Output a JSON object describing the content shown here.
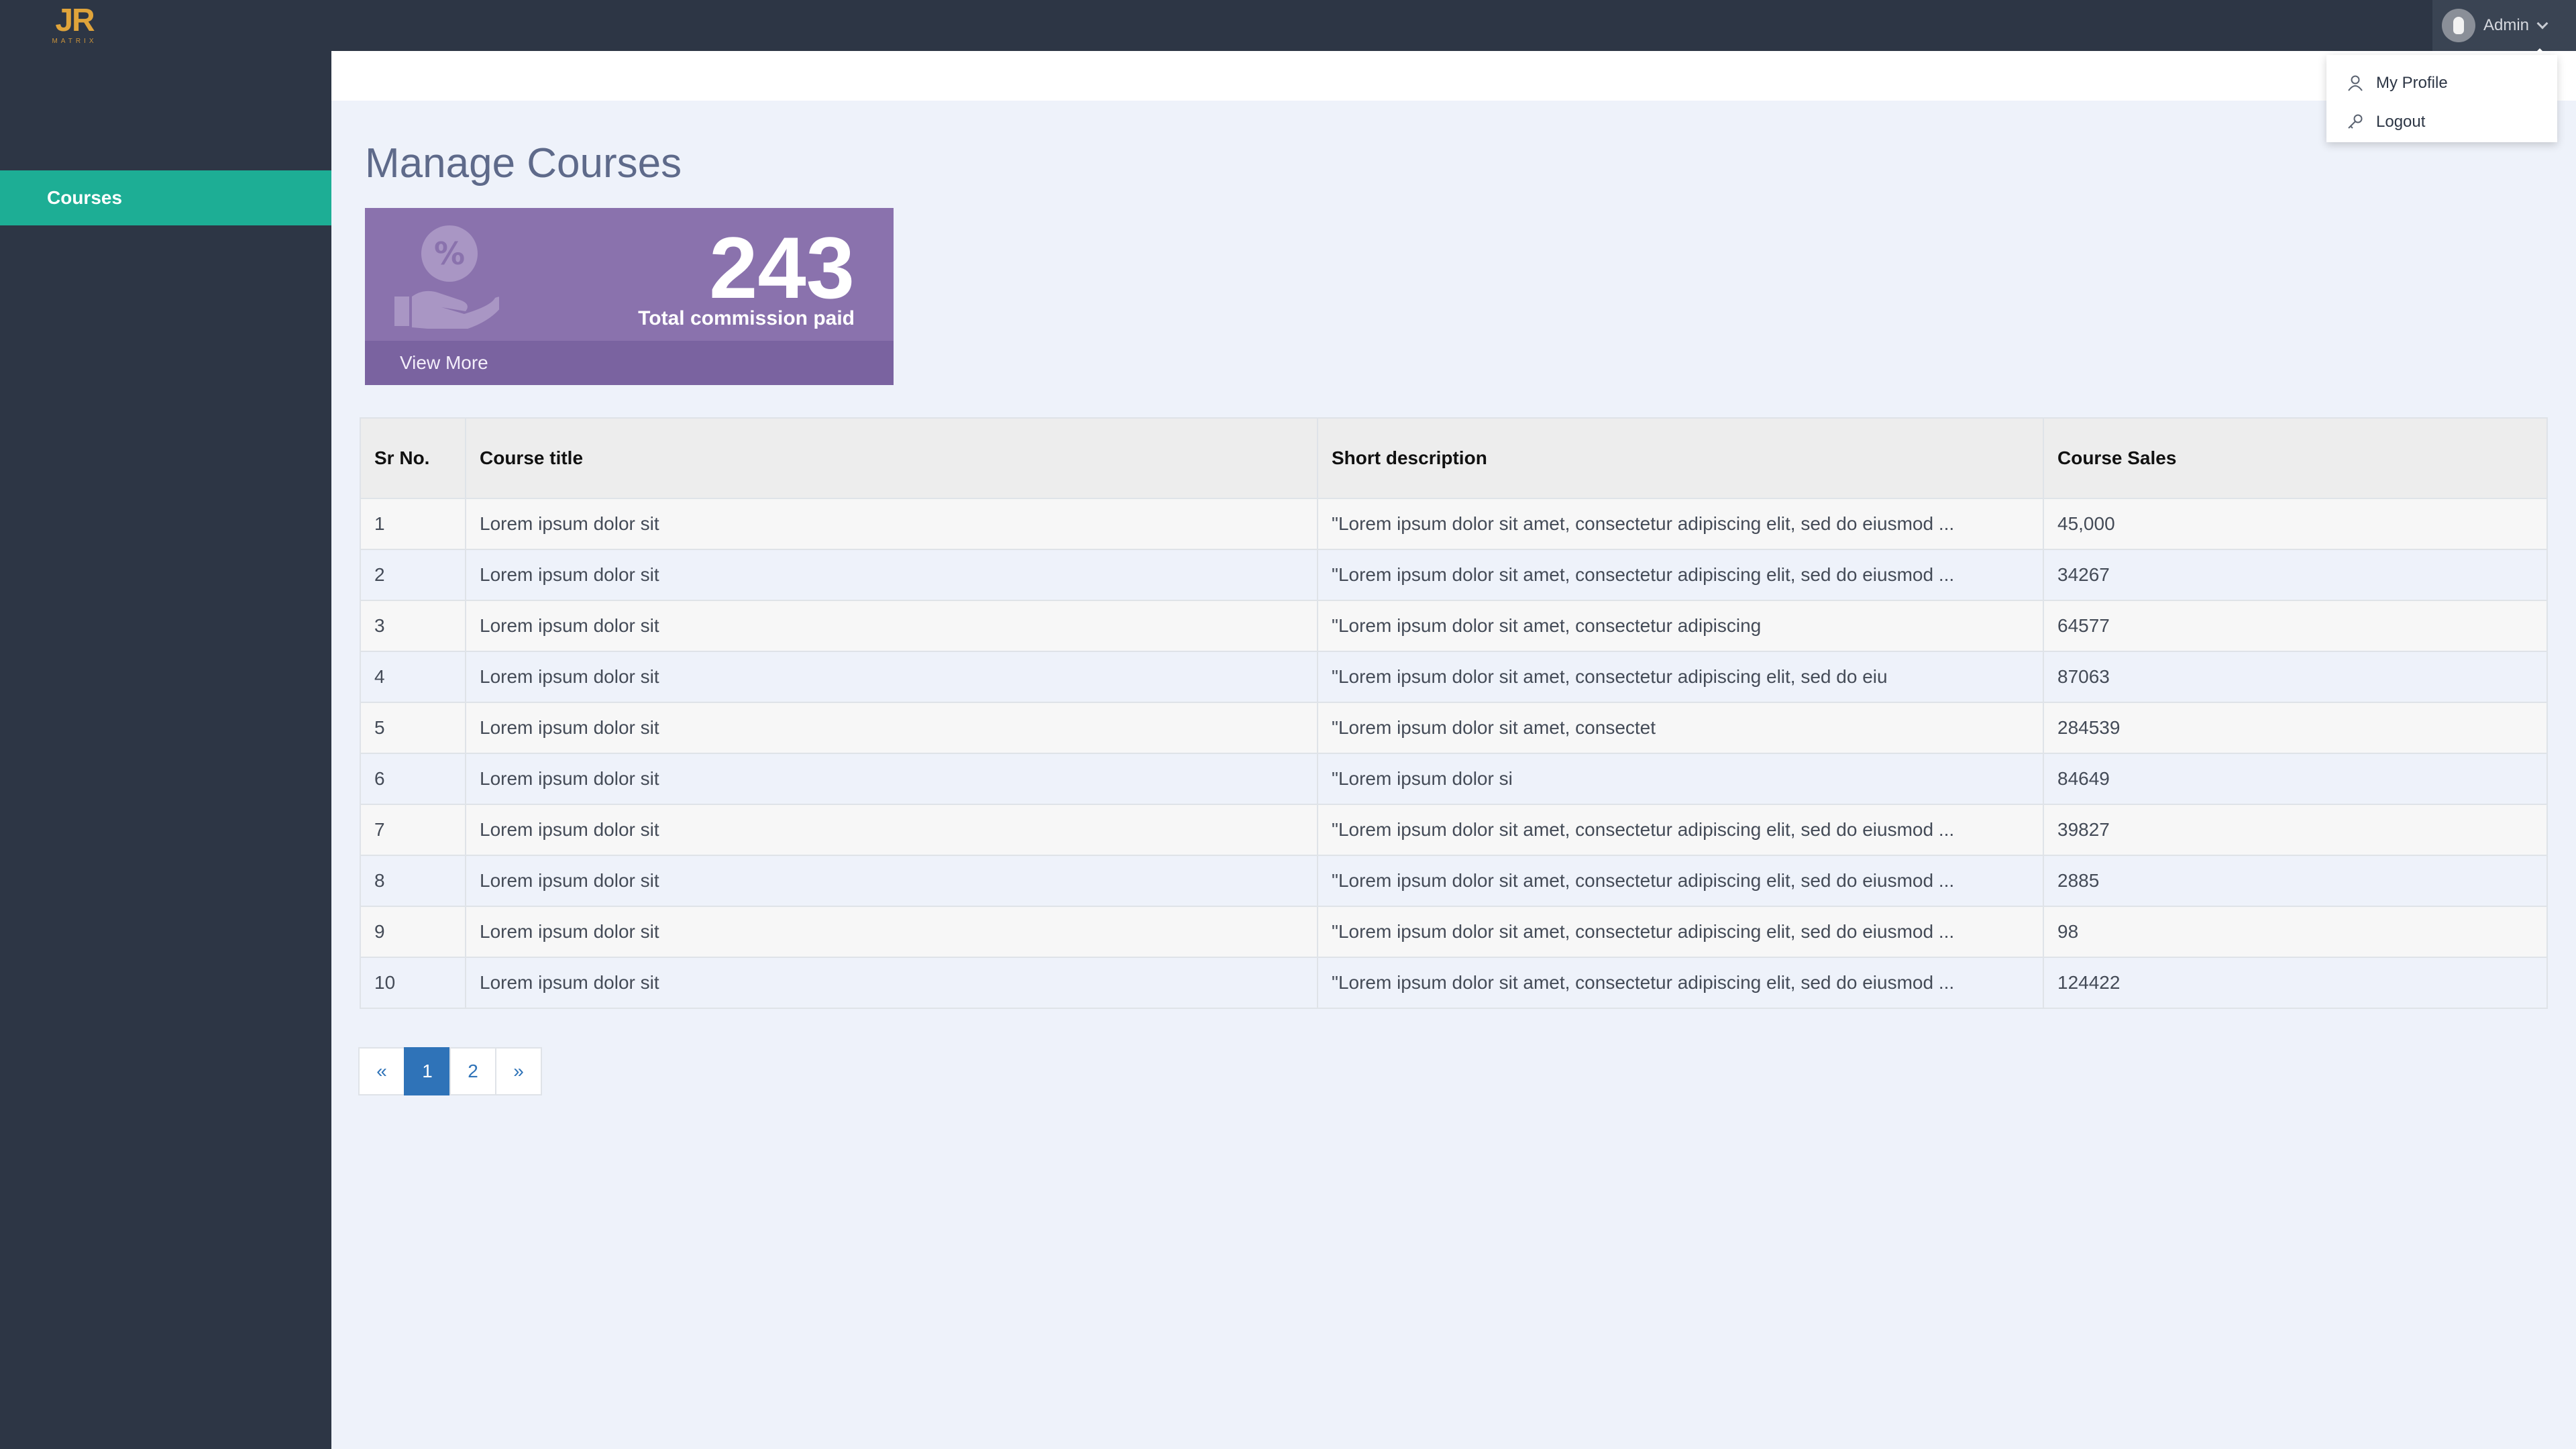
{
  "brand": {
    "logo_text": "JR",
    "logo_subtext": "MATRIX"
  },
  "header": {
    "user_name": "Admin"
  },
  "user_dropdown": {
    "items": [
      {
        "label": "My Profile",
        "icon": "user-icon"
      },
      {
        "label": "Logout",
        "icon": "key-icon"
      }
    ]
  },
  "sidebar": {
    "items": [
      {
        "label": "Courses",
        "active": true
      }
    ]
  },
  "page": {
    "title": "Manage Courses"
  },
  "stat_card": {
    "value": "243",
    "label": "Total commission paid",
    "link_label": "View More",
    "icon": "commission-hand-icon"
  },
  "table": {
    "headers": [
      "Sr No.",
      "Course title",
      "Short description",
      "Course Sales"
    ],
    "rows": [
      [
        "1",
        "Lorem ipsum dolor sit",
        "\"Lorem ipsum dolor sit amet, consectetur adipiscing elit, sed do eiusmod ...",
        "45,000"
      ],
      [
        "2",
        "Lorem ipsum dolor sit",
        "\"Lorem ipsum dolor sit amet, consectetur adipiscing elit, sed do eiusmod ...",
        "34267"
      ],
      [
        "3",
        "Lorem ipsum dolor sit",
        "\"Lorem ipsum dolor sit amet, consectetur adipiscing",
        "64577"
      ],
      [
        "4",
        "Lorem ipsum dolor sit",
        "\"Lorem ipsum dolor sit amet, consectetur adipiscing elit, sed do eiu",
        "87063"
      ],
      [
        "5",
        "Lorem ipsum dolor sit",
        "\"Lorem ipsum dolor sit amet, consectet",
        "284539"
      ],
      [
        "6",
        "Lorem ipsum dolor sit",
        "\"Lorem ipsum dolor si",
        "84649"
      ],
      [
        "7",
        "Lorem ipsum dolor sit",
        "\"Lorem ipsum dolor sit amet, consectetur adipiscing elit, sed do eiusmod ...",
        "39827"
      ],
      [
        "8",
        "Lorem ipsum dolor sit",
        "\"Lorem ipsum dolor sit amet, consectetur adipiscing elit, sed do eiusmod ...",
        "2885"
      ],
      [
        "9",
        "Lorem ipsum dolor sit",
        "\"Lorem ipsum dolor sit amet, consectetur adipiscing elit, sed do eiusmod ...",
        "98"
      ],
      [
        "10",
        "Lorem ipsum dolor sit",
        "\"Lorem ipsum dolor sit amet, consectetur adipiscing elit, sed do eiusmod ...",
        "124422"
      ]
    ]
  },
  "pagination": {
    "prev": "«",
    "pages": [
      "1",
      "2"
    ],
    "current": "1",
    "next": "»"
  },
  "colors": {
    "sidebar": "#2d3645",
    "active_item": "#1dae95",
    "stat_card": "#8a72ad",
    "page_bg": "#eef2fa",
    "pagination_active": "#2f73b8"
  }
}
